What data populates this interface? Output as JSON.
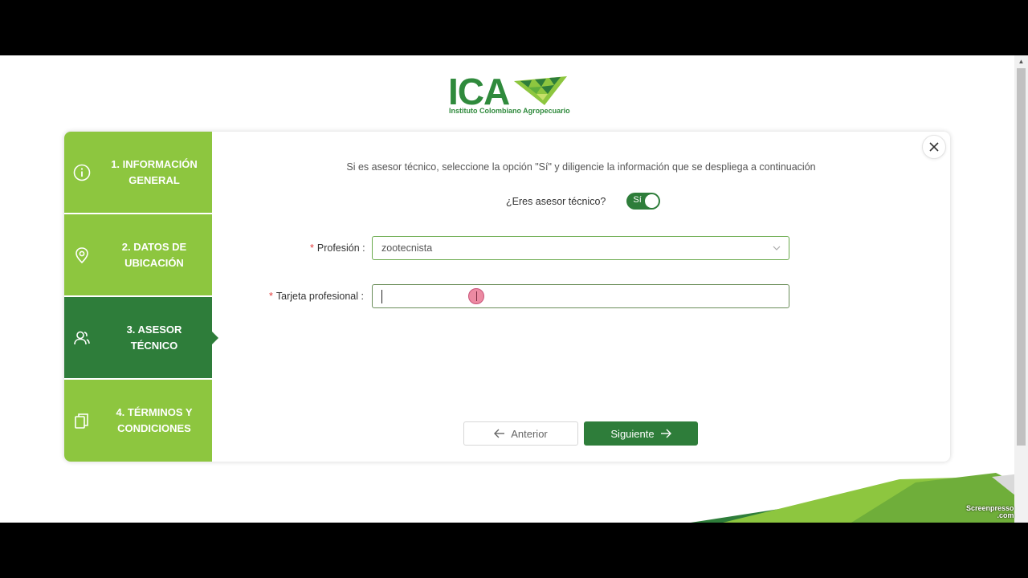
{
  "logo": {
    "name": "ICA",
    "subtitle": "Instituto Colombiano Agropecuario"
  },
  "steps": [
    {
      "label": "1. INFORMACIÓN GENERAL",
      "icon": "info-icon",
      "active": false
    },
    {
      "label": "2. DATOS DE UBICACIÓN",
      "icon": "location-pin-icon",
      "active": false
    },
    {
      "label": "3. ASESOR TÉCNICO",
      "icon": "users-icon",
      "active": true
    },
    {
      "label": "4. TÉRMINOS Y CONDICIONES",
      "icon": "documents-icon",
      "active": false
    }
  ],
  "intro_text": "Si es asesor técnico, seleccione la opción \"Sí\" y diligencie la información que se despliega a continuación",
  "toggle": {
    "label": "¿Eres asesor técnico?",
    "value_text": "Sí",
    "checked": true
  },
  "profesion": {
    "label": "Profesión",
    "required_mark": "*",
    "value": "zootecnista"
  },
  "tarjeta": {
    "label": "Tarjeta profesional",
    "required_mark": "*",
    "value": ""
  },
  "buttons": {
    "prev_label": "Anterior",
    "next_label": "Siguiente"
  },
  "watermark": {
    "line1": "Screenpresso",
    "line2": ".com"
  },
  "colors": {
    "brand_green": "#2e7d3a",
    "light_green": "#8dc63f",
    "required": "#e23b3b"
  }
}
